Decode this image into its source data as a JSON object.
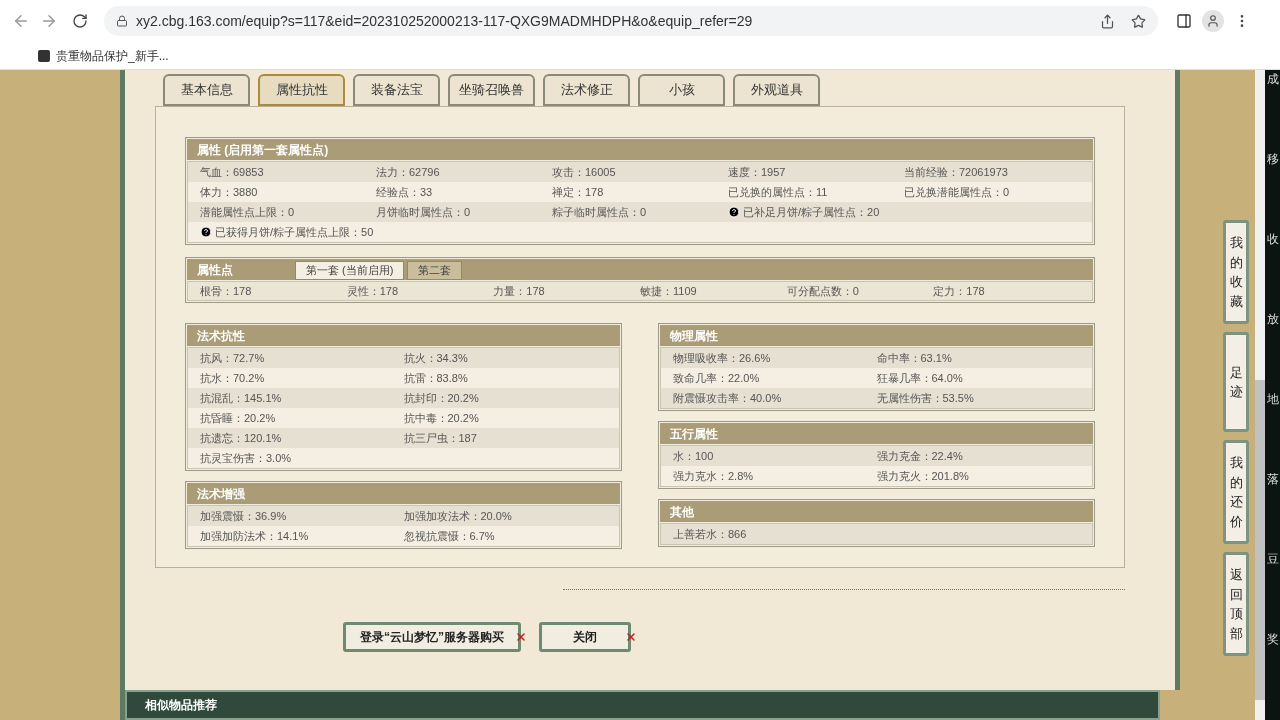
{
  "browser": {
    "url": "xy2.cbg.163.com/equip?s=117&eid=202310252000213-117-QXG9MADMHDPH&o&equip_refer=29",
    "bookmark": "贵重物品保护_新手..."
  },
  "tabs": [
    {
      "label": "基本信息",
      "selected": false
    },
    {
      "label": "属性抗性",
      "selected": true
    },
    {
      "label": "装备法宝",
      "selected": false
    },
    {
      "label": "坐骑召唤兽",
      "selected": false
    },
    {
      "label": "法术修正",
      "selected": false
    },
    {
      "label": "小孩",
      "selected": false
    },
    {
      "label": "外观道具",
      "selected": false
    }
  ],
  "attributes": {
    "title": "属性 (启用第一套属性点)",
    "rows": [
      [
        {
          "text": "气血：69853"
        },
        {
          "text": "法力：62796"
        },
        {
          "text": "攻击：16005"
        },
        {
          "text": "速度：1957"
        },
        {
          "text": "当前经验：72061973"
        }
      ],
      [
        {
          "text": "体力：3880"
        },
        {
          "text": "经验点：33"
        },
        {
          "text": "禅定：178"
        },
        {
          "text": "已兑换的属性点：11"
        },
        {
          "text": "已兑换潜能属性点：0"
        }
      ],
      [
        {
          "text": "潜能属性点上限：0"
        },
        {
          "text": "月饼临时属性点：0"
        },
        {
          "text": "粽子临时属性点：0"
        },
        {
          "text": "已补足月饼/粽子属性点：20",
          "help": true
        }
      ],
      [
        {
          "text": "已获得月饼/粽子属性点上限：50",
          "help": true
        }
      ]
    ]
  },
  "points": {
    "title": "属性点",
    "sets": [
      {
        "label": "第一套 (当前启用)",
        "selected": true
      },
      {
        "label": "第二套",
        "selected": false
      }
    ],
    "values": [
      "根骨：178",
      "灵性：178",
      "力量：178",
      "敏捷：1109",
      "可分配点数：0",
      "定力：178"
    ]
  },
  "left_sections": [
    {
      "title": "法术抗性",
      "rows": [
        [
          "抗风：72.7%",
          "抗火：34.3%"
        ],
        [
          "抗水：70.2%",
          "抗雷：83.8%"
        ],
        [
          "抗混乱：145.1%",
          "抗封印：20.2%"
        ],
        [
          "抗昏睡：20.2%",
          "抗中毒：20.2%"
        ],
        [
          "抗遗忘：120.1%",
          "抗三尸虫：187"
        ],
        [
          "抗灵宝伤害：3.0%"
        ]
      ]
    },
    {
      "title": "法术增强",
      "rows": [
        [
          "加强震慑：36.9%",
          "加强加攻法术：20.0%"
        ],
        [
          "加强加防法术：14.1%",
          "忽视抗震慑：6.7%"
        ]
      ]
    }
  ],
  "right_sections": [
    {
      "title": "物理属性",
      "rows": [
        [
          "物理吸收率：26.6%",
          "命中率：63.1%"
        ],
        [
          "致命几率：22.0%",
          "狂暴几率：64.0%"
        ],
        [
          "附震慑攻击率：40.0%",
          "无属性伤害：53.5%"
        ]
      ]
    },
    {
      "title": "五行属性",
      "rows": [
        [
          "水：100",
          "强力克金：22.4%"
        ],
        [
          "强力克水：2.8%",
          "强力克火：201.8%"
        ]
      ]
    },
    {
      "title": "其他",
      "rows": [
        [
          "上善若水：866"
        ]
      ]
    }
  ],
  "buttons": [
    "登录“云山梦忆”服务器购买",
    "关闭"
  ],
  "side_buttons": [
    "我的收藏",
    "足迹",
    "我的还价",
    "返回顶部"
  ],
  "bottom_bar": {
    "title": "相似物品推荐"
  },
  "side_app_strip": [
    "成",
    "移",
    "收",
    "放",
    "地",
    "落",
    "豆",
    "奖"
  ]
}
